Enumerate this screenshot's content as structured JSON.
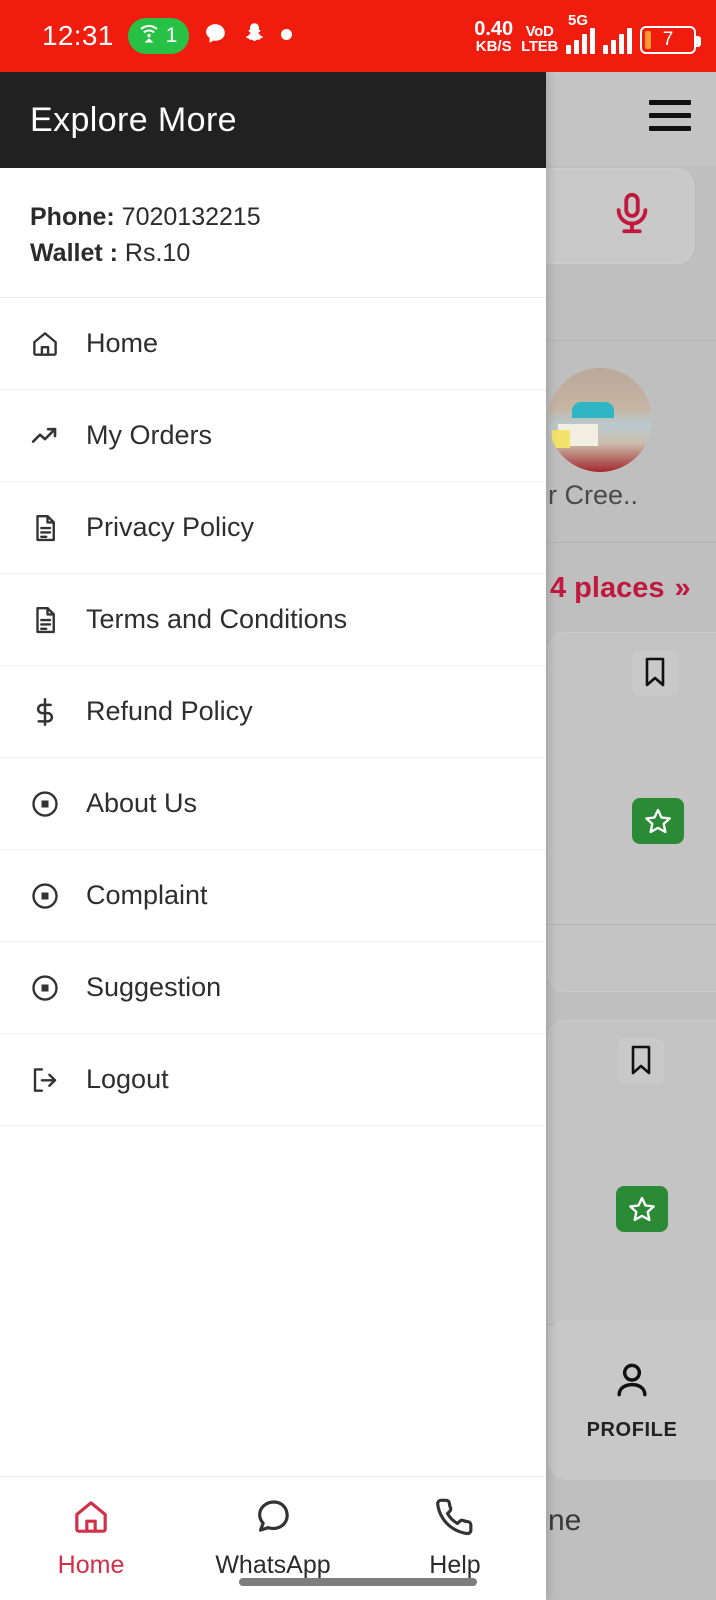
{
  "status_bar": {
    "time": "12:31",
    "hotspot_badge_count": "1",
    "hotspot_icon": "wifi-tethering-icon",
    "notification_icons": [
      "chat-bubble-icon",
      "snapchat-icon",
      "dot-icon"
    ],
    "net_speed_value": "0.40",
    "net_speed_unit": "KB/S",
    "volte_line1": "VoD",
    "volte_line2": "LTEB",
    "network_type": "5G",
    "battery_percent": "7",
    "background_color": "#f01c0e"
  },
  "drawer": {
    "title": "Explore More",
    "header_background": "#212121",
    "account": {
      "phone_label": "Phone:",
      "phone_value": "7020132215",
      "wallet_label": "Wallet :",
      "wallet_value": "Rs.10"
    },
    "items": [
      {
        "label": "Home",
        "icon": "home-icon"
      },
      {
        "label": "My Orders",
        "icon": "trending-up-icon"
      },
      {
        "label": "Privacy Policy",
        "icon": "document-icon"
      },
      {
        "label": "Terms and Conditions",
        "icon": "document-icon"
      },
      {
        "label": "Refund Policy",
        "icon": "dollar-icon"
      },
      {
        "label": "About Us",
        "icon": "disc-icon"
      },
      {
        "label": "Complaint",
        "icon": "disc-icon"
      },
      {
        "label": "Suggestion",
        "icon": "disc-icon"
      },
      {
        "label": "Logout",
        "icon": "logout-icon"
      }
    ]
  },
  "bottom_nav": {
    "active_color": "#d13048",
    "items": [
      {
        "label": "Home",
        "icon": "home-icon",
        "active": true
      },
      {
        "label": "WhatsApp",
        "icon": "chat-bubble-icon",
        "active": false
      },
      {
        "label": "Help",
        "icon": "phone-icon",
        "active": false
      }
    ]
  },
  "background_app": {
    "menu_icon": "hamburger-icon",
    "mic_icon": "microphone-icon",
    "mic_color": "#c0183f",
    "place_name_partial": "r Cree..",
    "places_link": "4 places",
    "places_chevron": "»",
    "bookmark_icon": "bookmark-icon",
    "star_icon": "star-icon",
    "star_badge_color": "#2a8a36",
    "profile_label": "PROFILE",
    "profile_icon": "person-icon",
    "tail_text": "ne"
  }
}
